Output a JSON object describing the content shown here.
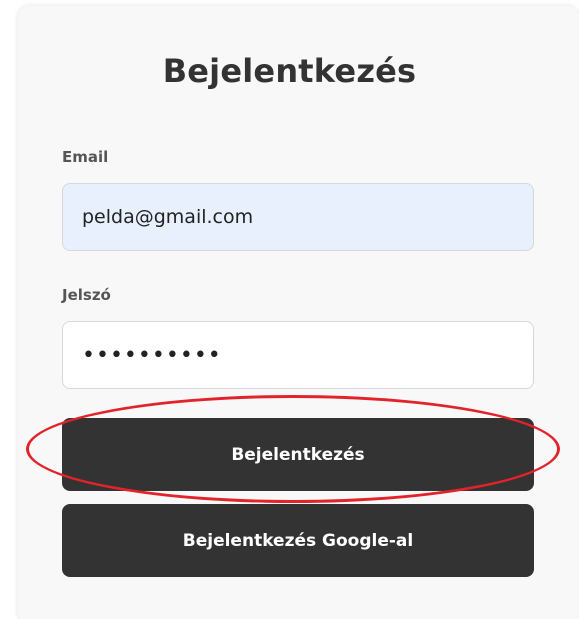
{
  "form": {
    "title": "Bejelentkezés",
    "email_label": "Email",
    "email_value": "pelda@gmail.com",
    "password_label": "Jelszó",
    "password_value": "••••••••••",
    "login_button": "Bejelentkezés",
    "google_button": "Bejelentkezés Google-al"
  },
  "colors": {
    "button_bg": "#333333",
    "email_field_bg": "#e8f0fe",
    "highlight": "#e2232a"
  }
}
